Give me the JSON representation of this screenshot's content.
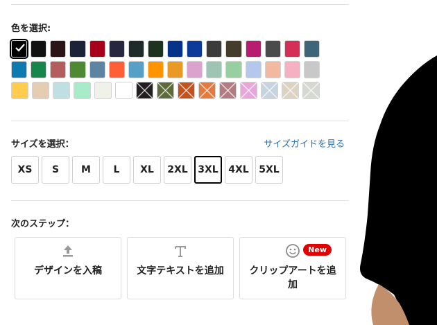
{
  "color_section": {
    "label": "色を選択:",
    "swatch_rows": [
      [
        {
          "color": "#000000",
          "selected": true
        },
        {
          "color": "#111111"
        },
        {
          "color": "#2a1416"
        },
        {
          "color": "#1c2238"
        },
        {
          "color": "#a8001a"
        },
        {
          "color": "#272740"
        },
        {
          "color": "#1f2a2a"
        },
        {
          "color": "#1d3320"
        },
        {
          "color": "#05338a"
        },
        {
          "color": "#0a3a9a"
        },
        {
          "color": "#3b3b3b"
        },
        {
          "color": "#463c2a"
        },
        {
          "color": "#b81c6e"
        },
        {
          "color": "#4b4b4b"
        },
        {
          "color": "#d42f57"
        },
        {
          "color": "#3d6678"
        }
      ],
      [
        {
          "color": "#0f7ab0"
        },
        {
          "color": "#16864a"
        },
        {
          "color": "#b45d5d"
        },
        {
          "color": "#4e8a34"
        },
        {
          "color": "#5e84a3"
        },
        {
          "color": "#ff5e36"
        },
        {
          "color": "#56a0c8"
        },
        {
          "color": "#ff9400"
        },
        {
          "color": "#ea9a24"
        },
        {
          "color": "#dba2cd"
        },
        {
          "color": "#9ec4b4"
        },
        {
          "color": "#97cfa0"
        },
        {
          "color": "#b4c8ee"
        },
        {
          "color": "#f3b9a0"
        },
        {
          "color": "#f6b0c2"
        },
        {
          "color": "#c8c8c8"
        }
      ],
      [
        {
          "color": "#ffcc4d"
        },
        {
          "color": "#e4cdb0"
        },
        {
          "color": "#bfe0e2"
        },
        {
          "color": "#a8ebc8"
        },
        {
          "color": "#f0f1e8"
        },
        {
          "color": "#ffffff"
        },
        {
          "color": "#231f20",
          "crossed": true
        },
        {
          "color": "#5d6b3a",
          "crossed": true
        },
        {
          "color": "#c2521f",
          "crossed": true
        },
        {
          "color": "#e57a3e",
          "crossed": true
        },
        {
          "color": "#b27c82",
          "crossed": true
        },
        {
          "color": "#e8a6dc",
          "crossed": true
        },
        {
          "color": "#c7d3de",
          "crossed": true
        },
        {
          "color": "#ddd3c3",
          "crossed": true
        },
        {
          "color": "#d6d8d2",
          "crossed": true
        }
      ]
    ]
  },
  "size_section": {
    "label": "サイズを選択：",
    "guide_link": "サイズガイドを見る",
    "sizes": [
      "XS",
      "S",
      "M",
      "L",
      "XL",
      "2XL",
      "3XL",
      "4XL",
      "5XL"
    ],
    "selected_size": "3XL"
  },
  "next_steps": {
    "label": "次のステップ：",
    "cards": [
      {
        "icon": "upload-icon",
        "label": "デザインを入稿"
      },
      {
        "icon": "text-icon",
        "label": "文字テキストを追加"
      },
      {
        "icon": "smiley-icon",
        "label": "クリップアートを追加",
        "badge": "New"
      }
    ]
  },
  "colors": {
    "link": "#2f6fb0",
    "badge": "#e00000",
    "selected_border": "#000000",
    "product_shirt": "#000000"
  }
}
